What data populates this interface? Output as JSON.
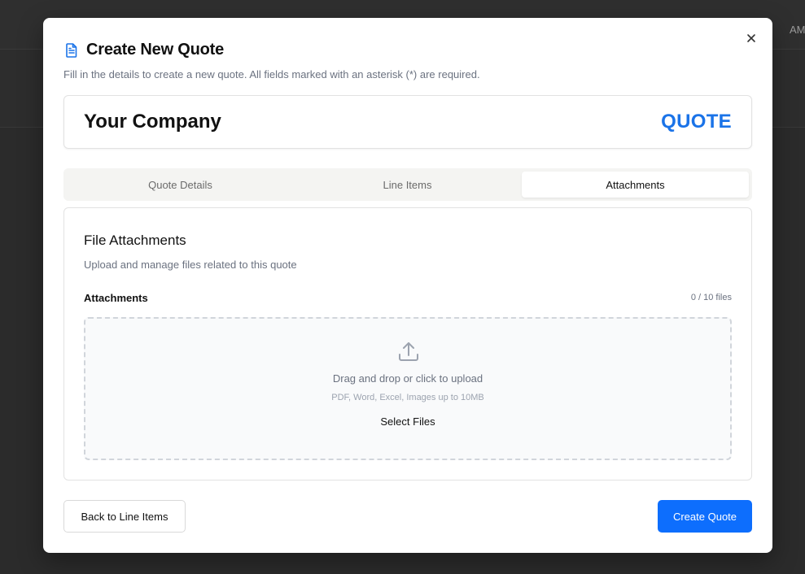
{
  "background": {
    "peek_text": "AM"
  },
  "modal": {
    "title": "Create New Quote",
    "subtitle": "Fill in the details to create a new quote. All fields marked with an asterisk (*) are required.",
    "title_icon": "document-icon",
    "close_icon": "close-icon"
  },
  "company": {
    "name": "Your Company",
    "doc_type": "QUOTE"
  },
  "tabs": [
    {
      "label": "Quote Details",
      "active": false
    },
    {
      "label": "Line Items",
      "active": false
    },
    {
      "label": "Attachments",
      "active": true
    }
  ],
  "attachments": {
    "section_title": "File Attachments",
    "section_desc": "Upload and manage files related to this quote",
    "field_label": "Attachments",
    "file_count": "0 / 10 files",
    "dropzone": {
      "icon": "upload-icon",
      "text": "Drag and drop or click to upload",
      "hint": "PDF, Word, Excel, Images up to 10MB",
      "button": "Select Files"
    }
  },
  "footer": {
    "back_label": "Back to Line Items",
    "create_label": "Create Quote"
  },
  "colors": {
    "accent": "#0d6efd",
    "quote_blue": "#1a73e8",
    "overlay": "#2b2b2b"
  }
}
